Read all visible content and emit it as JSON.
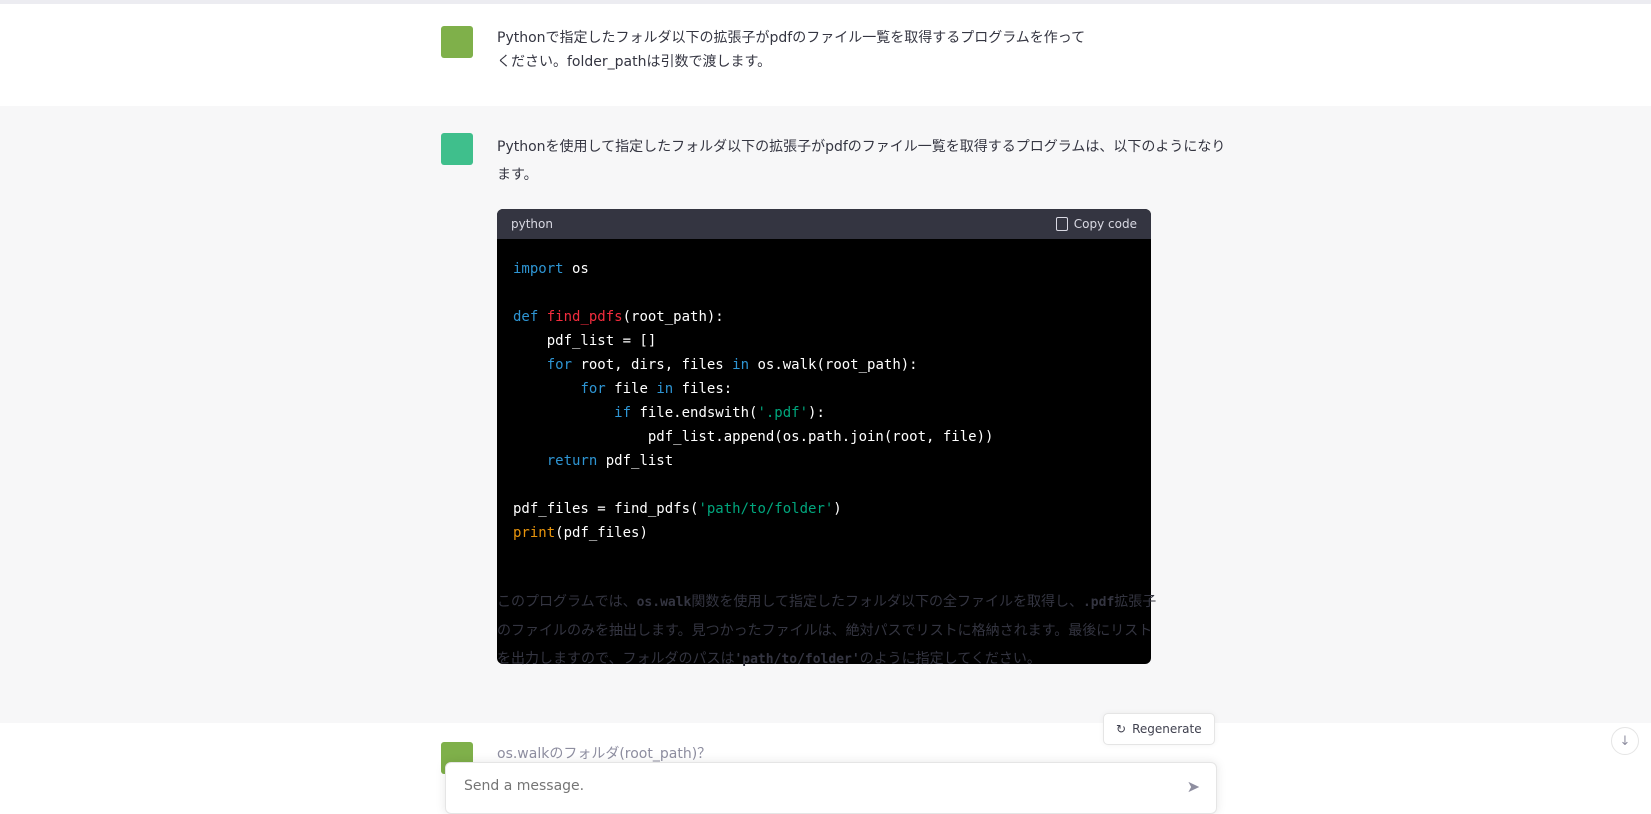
{
  "conversation": {
    "user_message": "Pythonで指定したフォルダ以下の拡張子がpdfのファイル一覧を取得するプログラムを作ってください。folder_pathは引数で渡します。",
    "assistant_intro": "Pythonを使用して指定したフォルダ以下の拡張子がpdfのファイル一覧を取得するプログラムは、以下のようになります。",
    "code_language": "python",
    "copy_label": "Copy code",
    "code": {
      "l1_kw": "import",
      "l1_rest": " os",
      "l3_kw": "def",
      "l3_fn": "find_pdfs",
      "l3_rest": "(root_path):",
      "l4": "    pdf_list = []",
      "l5_indent": "    ",
      "l5_kw1": "for",
      "l5_mid": " root, dirs, files ",
      "l5_kw2": "in",
      "l5_rest": " os.walk(root_path):",
      "l6_indent": "        ",
      "l6_kw1": "for",
      "l6_mid": " file ",
      "l6_kw2": "in",
      "l6_rest": " files:",
      "l7_indent": "            ",
      "l7_kw": "if",
      "l7_mid": " file.endswith(",
      "l7_str": "'.pdf'",
      "l7_rest": "):",
      "l8": "                pdf_list.append(os.path.join(root, file))",
      "l9_indent": "    ",
      "l9_kw": "return",
      "l9_rest": " pdf_list",
      "l11_pre": "pdf_files = find_pdfs(",
      "l11_str": "'path/to/folder'",
      "l11_post": ")",
      "l12_bi": "print",
      "l12_rest": "(pdf_files)"
    },
    "explain_part1": "このプログラムでは、",
    "explain_code1": "os.walk",
    "explain_part2": "関数を使用して指定したフォルダ以下の全ファイルを取得し、",
    "explain_code2": ".pdf",
    "explain_part3": "拡張子のファイルのみを抽出します。見つかったファイルは、絶対パスでリストに格納されます。最後にリストを出力しますので、フォルダのパスは",
    "explain_code3": "'path/to/folder'",
    "explain_part4": "のように指定してください。",
    "regenerate_label": "Regenerate",
    "next_user_message": "os.walkのフォルダ(root_path)？",
    "input_placeholder": "Send a message."
  }
}
